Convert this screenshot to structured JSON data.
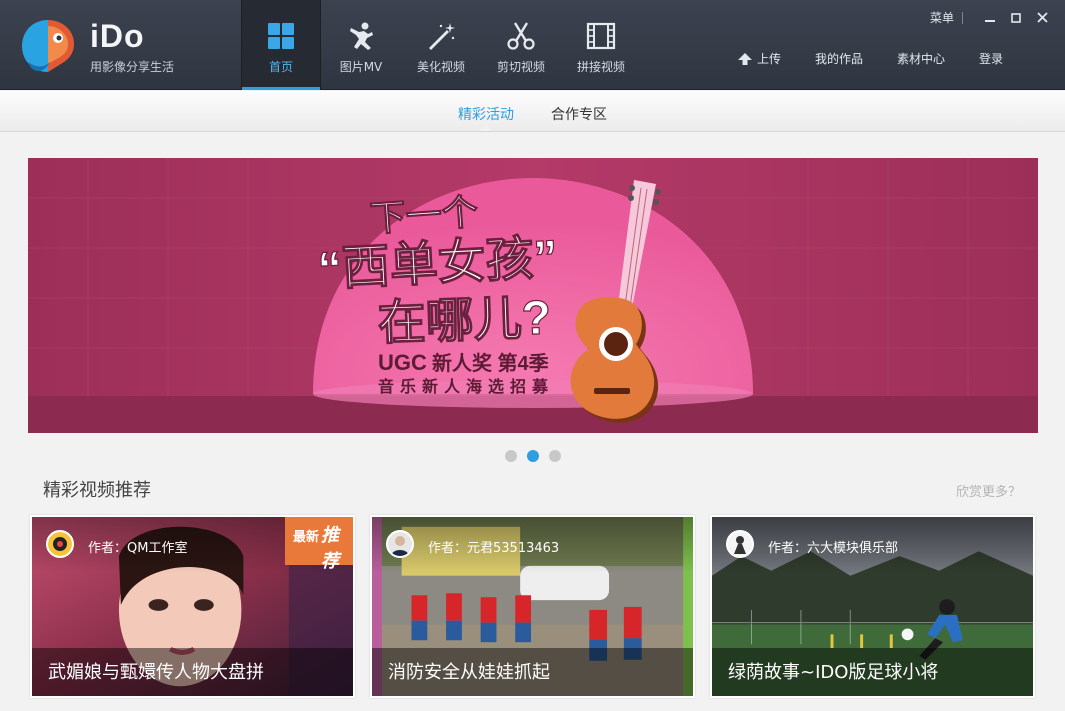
{
  "app": {
    "brand_name": "iDo",
    "slogan": "用影像分享生活"
  },
  "nav": [
    {
      "label": "首页",
      "icon": "home-grid-icon",
      "active": true
    },
    {
      "label": "图片MV",
      "icon": "dancing-person-icon",
      "active": false
    },
    {
      "label": "美化视频",
      "icon": "magic-wand-icon",
      "active": false
    },
    {
      "label": "剪切视频",
      "icon": "scissors-icon",
      "active": false
    },
    {
      "label": "拼接视频",
      "icon": "film-strip-icon",
      "active": false
    }
  ],
  "top_links": {
    "upload": "上传",
    "my_works": "我的作品",
    "material_center": "素材中心",
    "login": "登录"
  },
  "window": {
    "menu": "菜单"
  },
  "subtabs": [
    {
      "label": "精彩活动",
      "active": true
    },
    {
      "label": "合作专区",
      "active": false
    }
  ],
  "banner": {
    "line1": "下一个",
    "line2": "“西单女孩”",
    "line3": "在哪儿?",
    "line4_a": "UGC",
    "line4_b": "新人奖 第4季",
    "line5": "音乐新人海选招募"
  },
  "carousel": {
    "count": 3,
    "active_index": 1
  },
  "section": {
    "title": "精彩视频推荐",
    "more": "欣赏更多？"
  },
  "videos": [
    {
      "author": "作者：QM工作室",
      "title": "武媚娘与甄嬛传人物大盘拼",
      "badge_a": "最新",
      "badge_b": "推荐"
    },
    {
      "author": "作者：元君53513463",
      "title": "消防安全从娃娃抓起"
    },
    {
      "author": "作者：六大模块俱乐部",
      "title": "绿荫故事~IDO版足球小将"
    }
  ],
  "colors": {
    "accent": "#2d9fe0",
    "topbar": "#363c47",
    "banner_bg": "#a8345f",
    "banner_spot": "#f06aa5"
  }
}
